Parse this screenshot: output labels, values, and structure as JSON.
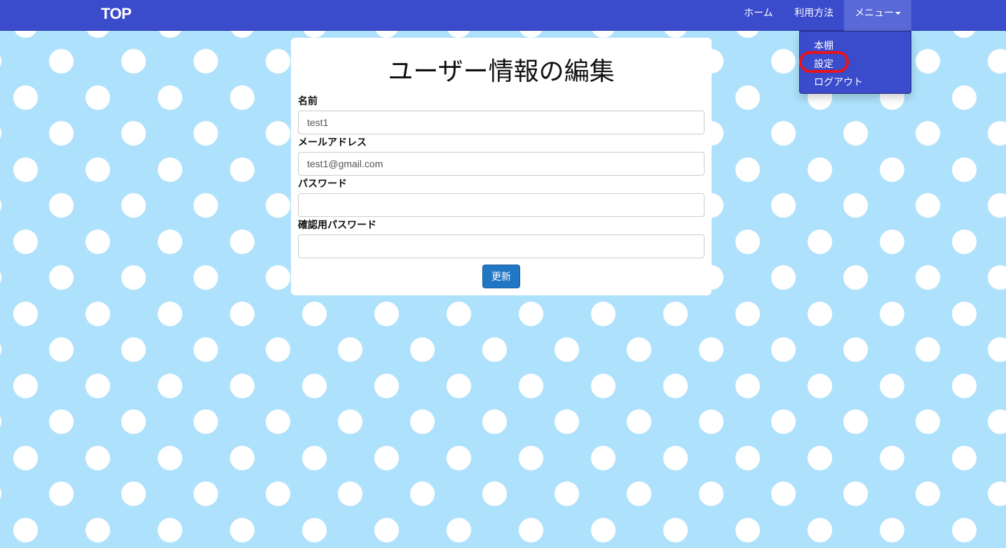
{
  "navbar": {
    "brand": "TOP",
    "links": {
      "home": "ホーム",
      "usage": "利用方法",
      "menu": "メニュー"
    },
    "background_color": "#3a4bcc"
  },
  "dropdown": {
    "items": [
      {
        "label": "本棚"
      },
      {
        "label": "設定"
      },
      {
        "label": "ログアウト"
      }
    ],
    "highlight_color": "#e8141b"
  },
  "form": {
    "title": "ユーザー情報の編集",
    "fields": {
      "name": {
        "label": "名前",
        "value": "test1"
      },
      "email": {
        "label": "メールアドレス",
        "value": "test1@gmail.com"
      },
      "password": {
        "label": "パスワード",
        "value": ""
      },
      "password_confirm": {
        "label": "確認用パスワード",
        "value": ""
      }
    },
    "submit_label": "更新",
    "submit_color": "#2277c4"
  },
  "page": {
    "background_color": "#aee1fb",
    "dot_color": "#ffffff"
  }
}
